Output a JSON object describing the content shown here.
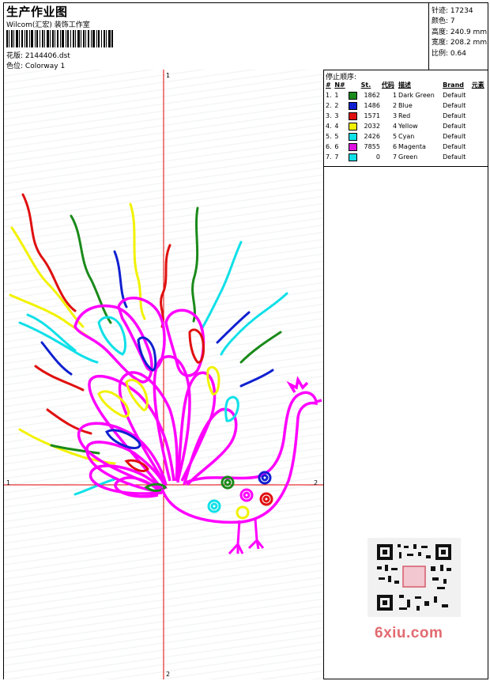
{
  "header": {
    "title": "生产作业图",
    "company": "Wilcom(汇宏) 装饰工作室",
    "design_label": "花版:",
    "design_file": "2144406.dst",
    "colorway_label": "色位:",
    "colorway": "Colorway 1"
  },
  "stats": {
    "stitches_label": "针迹:",
    "stitches": "17234",
    "colors_label": "颜色:",
    "colors": "7",
    "height_label": "高度:",
    "height": "240.9 mm",
    "width_label": "宽度:",
    "width": "208.2 mm",
    "scale_label": "比例:",
    "scale": "0.64"
  },
  "stop_sequence": {
    "title": "停止顺序:",
    "columns": [
      "#",
      "N#",
      "St.",
      "代码",
      "描述",
      "Brand",
      "元素"
    ],
    "rows": [
      {
        "idx": "1.",
        "n": "1",
        "color": "#1a8a1a",
        "st": "1862",
        "code": "1",
        "desc": "Dark Green",
        "brand": "Default"
      },
      {
        "idx": "2.",
        "n": "2",
        "color": "#1020d0",
        "st": "1486",
        "code": "2",
        "desc": "Blue",
        "brand": "Default"
      },
      {
        "idx": "3.",
        "n": "3",
        "color": "#e01010",
        "st": "1571",
        "code": "3",
        "desc": "Red",
        "brand": "Default"
      },
      {
        "idx": "4.",
        "n": "4",
        "color": "#f2f200",
        "st": "2032",
        "code": "4",
        "desc": "Yellow",
        "brand": "Default"
      },
      {
        "idx": "5.",
        "n": "5",
        "color": "#10e0e8",
        "st": "2426",
        "code": "5",
        "desc": "Cyan",
        "brand": "Default"
      },
      {
        "idx": "6.",
        "n": "6",
        "color": "#e010e0",
        "st": "7855",
        "code": "6",
        "desc": "Magenta",
        "brand": "Default"
      },
      {
        "idx": "7.",
        "n": "7",
        "color": "#10e0e8",
        "st": "0",
        "code": "7",
        "desc": "Green",
        "brand": "Default"
      }
    ]
  },
  "axes": {
    "top": "1",
    "left": "1",
    "right": "2",
    "bottom": "2"
  },
  "watermark": {
    "site": "6xiu.com"
  },
  "colors": {
    "axis": "#e00000",
    "magenta": "#ff00ff"
  }
}
